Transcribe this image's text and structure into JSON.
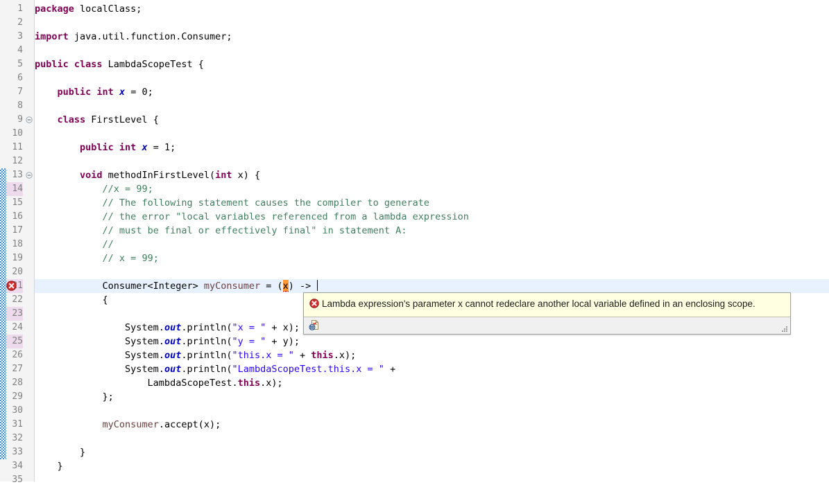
{
  "editor": {
    "language": "java",
    "file_class": "LambdaScopeTest",
    "current_line": 21,
    "changed_lines": [
      14,
      21,
      23,
      25
    ],
    "change_bar_range": [
      13,
      33
    ],
    "folding_markers": [
      9,
      13
    ],
    "colors": {
      "keyword": "#7F0055",
      "comment": "#3F7F5F",
      "string": "#2A00FF",
      "field": "#0000C0",
      "local_variable": "#6A3E3E",
      "current_line_highlight": "#E8F2FE",
      "changed_line_number_bg": "#EDDAED",
      "occurrence_highlight": "#FF9933",
      "error_underline": "#E00000",
      "change_bar": "#3A8FD6",
      "ruler_bg": "#F4F4F4",
      "tooltip_bg": "#FFFFE1",
      "tooltip_border": "#A0A0A0"
    },
    "lines": [
      {
        "n": 1,
        "tokens": [
          {
            "t": "kw",
            "v": "package"
          },
          {
            "t": "plain",
            "v": " localClass;"
          }
        ]
      },
      {
        "n": 2,
        "tokens": []
      },
      {
        "n": 3,
        "tokens": [
          {
            "t": "kw",
            "v": "import"
          },
          {
            "t": "plain",
            "v": " java.util.function.Consumer;"
          }
        ]
      },
      {
        "n": 4,
        "tokens": []
      },
      {
        "n": 5,
        "tokens": [
          {
            "t": "kw",
            "v": "public class"
          },
          {
            "t": "plain",
            "v": " LambdaScopeTest {"
          }
        ]
      },
      {
        "n": 6,
        "tokens": []
      },
      {
        "n": 7,
        "tokens": [
          {
            "t": "plain",
            "v": "    "
          },
          {
            "t": "kw",
            "v": "public int"
          },
          {
            "t": "plain",
            "v": " "
          },
          {
            "t": "fldx",
            "v": "x"
          },
          {
            "t": "plain",
            "v": " = 0;"
          }
        ]
      },
      {
        "n": 8,
        "tokens": []
      },
      {
        "n": 9,
        "tokens": [
          {
            "t": "plain",
            "v": "    "
          },
          {
            "t": "kw",
            "v": "class"
          },
          {
            "t": "plain",
            "v": " FirstLevel {"
          }
        ]
      },
      {
        "n": 10,
        "tokens": []
      },
      {
        "n": 11,
        "tokens": [
          {
            "t": "plain",
            "v": "        "
          },
          {
            "t": "kw",
            "v": "public int"
          },
          {
            "t": "plain",
            "v": " "
          },
          {
            "t": "fldx",
            "v": "x"
          },
          {
            "t": "plain",
            "v": " = 1;"
          }
        ]
      },
      {
        "n": 12,
        "tokens": []
      },
      {
        "n": 13,
        "tokens": [
          {
            "t": "plain",
            "v": "        "
          },
          {
            "t": "kw",
            "v": "void"
          },
          {
            "t": "plain",
            "v": " methodInFirstLevel("
          },
          {
            "t": "kw",
            "v": "int"
          },
          {
            "t": "plain",
            "v": " x) {"
          }
        ]
      },
      {
        "n": 14,
        "tokens": [
          {
            "t": "plain",
            "v": "            "
          },
          {
            "t": "cmt",
            "v": "//x = 99;"
          }
        ]
      },
      {
        "n": 15,
        "tokens": [
          {
            "t": "plain",
            "v": "            "
          },
          {
            "t": "cmt",
            "v": "// The following statement causes the compiler to generate"
          }
        ]
      },
      {
        "n": 16,
        "tokens": [
          {
            "t": "plain",
            "v": "            "
          },
          {
            "t": "cmt",
            "v": "// the error \"local variables referenced from a lambda expression"
          }
        ]
      },
      {
        "n": 17,
        "tokens": [
          {
            "t": "plain",
            "v": "            "
          },
          {
            "t": "cmt",
            "v": "// must be final or effectively final\" in statement A:"
          }
        ]
      },
      {
        "n": 18,
        "tokens": [
          {
            "t": "plain",
            "v": "            "
          },
          {
            "t": "cmt",
            "v": "//"
          }
        ]
      },
      {
        "n": 19,
        "tokens": [
          {
            "t": "plain",
            "v": "            "
          },
          {
            "t": "cmt",
            "v": "// x = 99;"
          }
        ]
      },
      {
        "n": 20,
        "tokens": []
      },
      {
        "n": 21,
        "tokens": [
          {
            "t": "plain",
            "v": "            Consumer<Integer> "
          },
          {
            "t": "lvar",
            "v": "myConsumer"
          },
          {
            "t": "plain",
            "v": " = ("
          },
          {
            "t": "occ",
            "v": "x"
          },
          {
            "t": "plain",
            "v": ") -> "
          },
          {
            "t": "caret",
            "v": ""
          }
        ]
      },
      {
        "n": 22,
        "tokens": [
          {
            "t": "plain",
            "v": "            {"
          }
        ]
      },
      {
        "n": 23,
        "tokens": []
      },
      {
        "n": 24,
        "tokens": [
          {
            "t": "plain",
            "v": "                System."
          },
          {
            "t": "fld",
            "v": "out"
          },
          {
            "t": "plain",
            "v": ".println("
          },
          {
            "t": "str",
            "v": "\"x = \""
          },
          {
            "t": "plain",
            "v": " + x);"
          }
        ]
      },
      {
        "n": 25,
        "tokens": [
          {
            "t": "plain",
            "v": "                System."
          },
          {
            "t": "fld",
            "v": "out"
          },
          {
            "t": "plain",
            "v": ".println("
          },
          {
            "t": "str",
            "v": "\"y = \""
          },
          {
            "t": "plain",
            "v": " + y);"
          }
        ]
      },
      {
        "n": 26,
        "tokens": [
          {
            "t": "plain",
            "v": "                System."
          },
          {
            "t": "fld",
            "v": "out"
          },
          {
            "t": "plain",
            "v": ".println("
          },
          {
            "t": "str",
            "v": "\"this.x = \""
          },
          {
            "t": "plain",
            "v": " + "
          },
          {
            "t": "kw",
            "v": "this"
          },
          {
            "t": "plain",
            "v": ".x);"
          }
        ]
      },
      {
        "n": 27,
        "tokens": [
          {
            "t": "plain",
            "v": "                System."
          },
          {
            "t": "fld",
            "v": "out"
          },
          {
            "t": "plain",
            "v": ".println("
          },
          {
            "t": "str",
            "v": "\"LambdaScopeTest.this.x = \""
          },
          {
            "t": "plain",
            "v": " +"
          }
        ]
      },
      {
        "n": 28,
        "tokens": [
          {
            "t": "plain",
            "v": "                    LambdaScopeTest."
          },
          {
            "t": "kw",
            "v": "this"
          },
          {
            "t": "plain",
            "v": ".x);"
          }
        ]
      },
      {
        "n": 29,
        "tokens": [
          {
            "t": "plain",
            "v": "            };"
          }
        ]
      },
      {
        "n": 30,
        "tokens": []
      },
      {
        "n": 31,
        "tokens": [
          {
            "t": "plain",
            "v": "            "
          },
          {
            "t": "lvar",
            "v": "myConsumer"
          },
          {
            "t": "plain",
            "v": ".accept(x);"
          }
        ]
      },
      {
        "n": 32,
        "tokens": []
      },
      {
        "n": 33,
        "tokens": [
          {
            "t": "plain",
            "v": "        }"
          }
        ]
      },
      {
        "n": 34,
        "tokens": [
          {
            "t": "plain",
            "v": "    }"
          }
        ]
      },
      {
        "n": 35,
        "tokens": []
      }
    ]
  },
  "error_marker": {
    "line": 21,
    "icon": "error-icon",
    "severity": "error"
  },
  "tooltip": {
    "icon": "error-icon",
    "message": "Lambda expression's parameter x cannot redeclare another local variable defined in an enclosing scope.",
    "quickfix_icon": "quick-fix-icon",
    "resize_grip_icon": "resize-grip-icon"
  }
}
